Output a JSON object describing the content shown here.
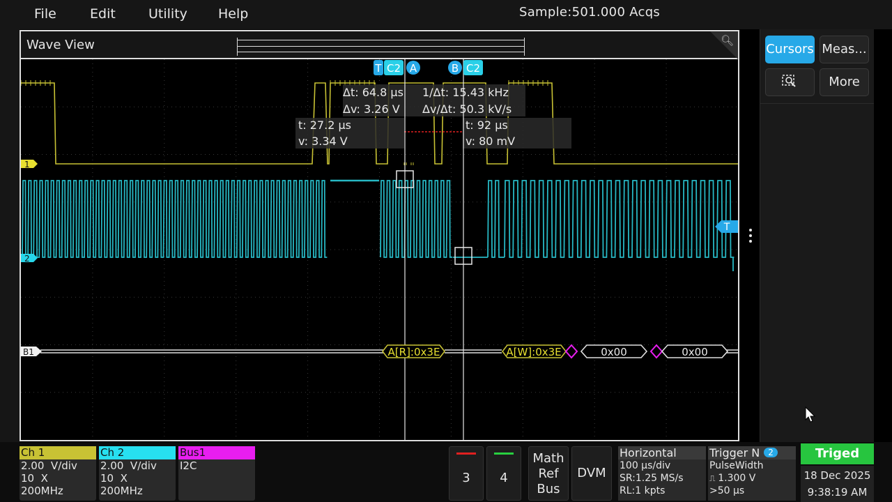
{
  "menu": {
    "file": "File",
    "edit": "Edit",
    "utility": "Utility",
    "help": "Help"
  },
  "acquisition": {
    "sample_text": "Sample:501.000  Acqs"
  },
  "wave_view": {
    "title": "Wave View",
    "markers": {
      "trigger_letter": "T",
      "c2_a": "C2",
      "cursor_a": "A",
      "cursor_b": "B",
      "c2_b": "C2"
    },
    "cursor_readout": {
      "dt": "Δt: 64.8 µs",
      "inv_dt": "1/Δt: 15.43 kHz",
      "dv": "Δv: 3.26  V",
      "dv_dt": "Δv/Δt: 50.3 kV/s",
      "a_t": "t: 27.2 µs",
      "a_v": "v: 3.34  V",
      "b_t": "t: 92 µs",
      "b_v": "v: 80 mV"
    },
    "channel_markers": {
      "ch1": "1",
      "ch2": "2",
      "bus": "B1",
      "trigger": "T"
    },
    "bus_decode": {
      "addr_read": "A[R]:0x3E",
      "addr_write": "A[W]:0x3E",
      "data1": "0x00",
      "data2": "0x00"
    },
    "colors": {
      "ch1": "#c8c234",
      "ch2": "#27b8c4",
      "bus": "#e0e0e0",
      "cursor": "#e8e8e8",
      "accent": "#27a9e8"
    }
  },
  "right_panel": {
    "cursors": "Cursors",
    "measure": "Meas...",
    "zoom_icon": "zoom-select-icon",
    "more": "More"
  },
  "bottom": {
    "ch1": {
      "label": "Ch 1",
      "scale": "2.00  V/div",
      "probe": "10  X",
      "bw": "200MHz",
      "color": "#c8c234"
    },
    "ch2": {
      "label": "Ch 2",
      "scale": "2.00  V/div",
      "probe": "10  X",
      "bw": "200MHz",
      "color": "#27e0f0"
    },
    "bus1": {
      "label": "Bus1",
      "protocol": "I2C",
      "color": "#e81ef0"
    },
    "ch3": {
      "label": "3",
      "color": "#e02020"
    },
    "ch4": {
      "label": "4",
      "color": "#28d040"
    },
    "math": {
      "line1": "Math",
      "line2": "Ref",
      "line3": "Bus"
    },
    "dvm": "DVM",
    "horizontal": {
      "title": "Horizontal",
      "scale": "100 µs/div",
      "sr": "SR:1.25 MS/s",
      "rl": "RL:1 kpts"
    },
    "trigger": {
      "title": "Trigger N",
      "badge": "2",
      "type": "PulseWidth",
      "level": "1.300  V",
      "cond": ">50 µs"
    },
    "status": "Triged",
    "date": "18 Dec 2025",
    "time": "9:38:19 AM"
  }
}
